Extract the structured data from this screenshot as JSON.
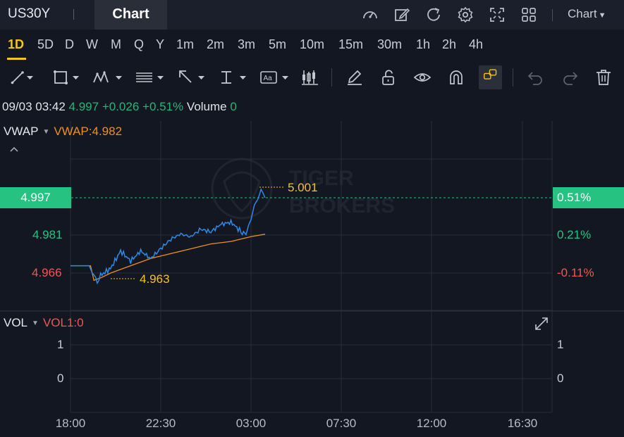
{
  "header": {
    "symbol": "US30Y",
    "tab_chart": "Chart",
    "chart_menu": "Chart",
    "icons": [
      "speedometer-icon",
      "edit-icon",
      "refresh-icon",
      "settings-icon",
      "expand-icon",
      "grid-icon"
    ]
  },
  "periods": [
    "1D",
    "5D",
    "D",
    "W",
    "M",
    "Q",
    "Y",
    "1m",
    "2m",
    "3m",
    "5m",
    "10m",
    "15m",
    "30m",
    "1h",
    "2h",
    "4h"
  ],
  "active_period": "1D",
  "tools": [
    "trend-line-icon",
    "rectangle-icon",
    "pattern-icon",
    "fibonacci-icon",
    "arrow-icon",
    "measure-icon",
    "text-icon",
    "candles-icon",
    "pencil-icon",
    "lock-icon",
    "eye-icon",
    "magnet-icon",
    "link-icon",
    "undo-icon",
    "redo-icon",
    "trash-icon"
  ],
  "quote": {
    "time": "09/03 03:42",
    "price": "4.997",
    "change": "+0.026",
    "change_pct": "+0.51%",
    "volume_label": "Volume",
    "volume": "0"
  },
  "price_indicator": {
    "name": "VWAP",
    "value_label": "VWAP:4.982"
  },
  "volume_indicator": {
    "name": "VOL",
    "value_label": "VOL1:0"
  },
  "y_axis": {
    "current": "4.997",
    "level_mid": "4.981",
    "level_low": "4.966",
    "pct_current": "0.51%",
    "pct_mid": "0.21%",
    "pct_low": "-0.11%"
  },
  "annotations": {
    "high": "5.001",
    "low": "4.963"
  },
  "vol_axis": {
    "left_top": "1",
    "left_bottom": "0",
    "right_top": "1",
    "right_bottom": "0"
  },
  "x_axis": [
    "18:00",
    "22:30",
    "03:00",
    "07:30",
    "12:00",
    "16:30"
  ],
  "watermark": {
    "line1": "TIGER",
    "line2": "BROKERS"
  },
  "colors": {
    "background": "#131722",
    "accent": "#f5c518",
    "up": "#26c281",
    "down": "#f0584e",
    "price_line": "#2e8ae6",
    "vwap_line": "#f0901a"
  },
  "chart_data": {
    "type": "line",
    "series": [
      {
        "name": "VWAP",
        "values_desc": "vwap",
        "x": [
          "18:00",
          "19:00",
          "19:10",
          "19:30",
          "20:00",
          "21:00",
          "22:00",
          "23:00",
          "00:00",
          "01:00",
          "02:00",
          "03:00",
          "03:42"
        ],
        "values": [
          4.969,
          4.969,
          4.963,
          4.964,
          4.966,
          4.969,
          4.972,
          4.974,
          4.976,
          4.978,
          4.979,
          4.981,
          4.982
        ]
      },
      {
        "name": "Price",
        "x": [
          "18:00",
          "19:00",
          "19:10",
          "19:20",
          "19:30",
          "20:00",
          "20:30",
          "21:00",
          "21:30",
          "22:00",
          "22:30",
          "23:00",
          "23:30",
          "00:00",
          "00:30",
          "01:00",
          "01:30",
          "02:00",
          "02:30",
          "02:45",
          "03:00",
          "03:10",
          "03:20",
          "03:30",
          "03:36",
          "03:42"
        ],
        "values": [
          4.969,
          4.969,
          4.964,
          4.963,
          4.965,
          4.968,
          4.975,
          4.971,
          4.975,
          4.972,
          4.976,
          4.98,
          4.982,
          4.981,
          4.984,
          4.983,
          4.986,
          4.987,
          4.983,
          4.982,
          4.988,
          4.994,
          4.996,
          5.001,
          4.999,
          4.997
        ]
      }
    ],
    "y_levels": [
      4.997,
      4.981,
      4.966
    ],
    "high": 5.001,
    "low": 4.963,
    "x_ticks": [
      "18:00",
      "22:30",
      "03:00",
      "07:30",
      "12:00",
      "16:30"
    ]
  }
}
